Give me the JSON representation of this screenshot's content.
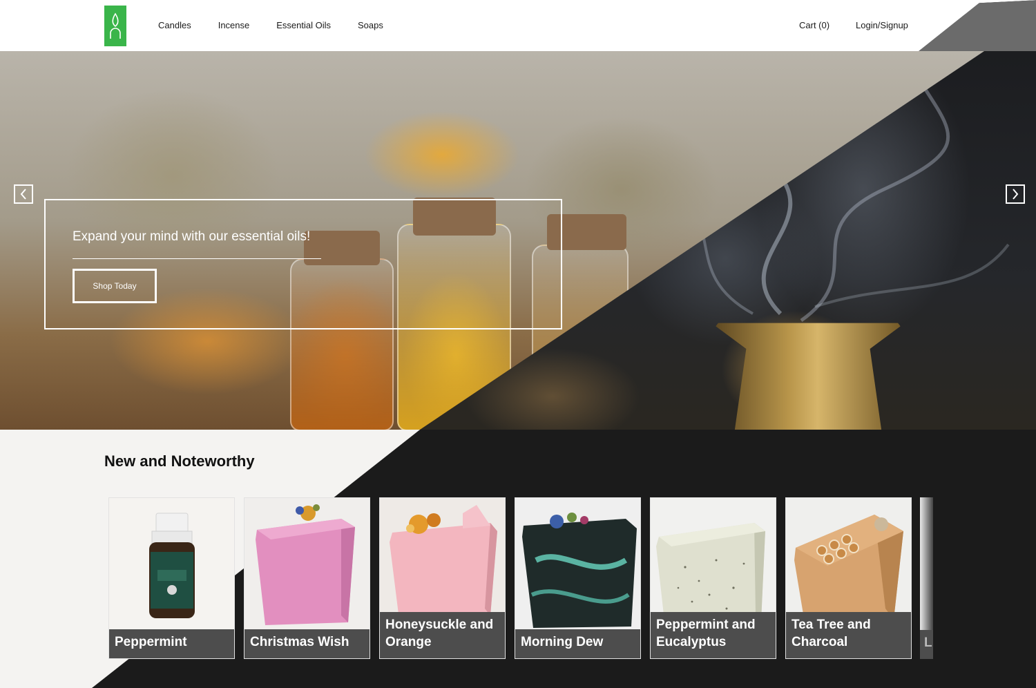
{
  "header": {
    "nav": [
      "Candles",
      "Incense",
      "Essential Oils",
      "Soaps"
    ],
    "cart_label": "Cart (0)",
    "login_label": "Login/Signup",
    "logo_icon": "flame-arch-logo-icon",
    "logo_color": "#3ab54a"
  },
  "hero": {
    "headline": "Expand your mind with our essential oils!",
    "cta_label": "Shop Today",
    "prev_icon": "chevron-left-icon",
    "next_icon": "chevron-right-icon"
  },
  "section": {
    "title": "New and Noteworthy"
  },
  "products": [
    {
      "name": "Peppermint",
      "line1": "Peppermint",
      "line2": ""
    },
    {
      "name": "Christmas Wish",
      "line1": "Christmas Wish",
      "line2": ""
    },
    {
      "name": "Honeysuckle and Orange",
      "line1": "Honeysuckle and",
      "line2": "Orange"
    },
    {
      "name": "Morning Dew",
      "line1": "Morning Dew",
      "line2": ""
    },
    {
      "name": "Peppermint and Eucalyptus",
      "line1": "Peppermint and",
      "line2": "Eucalyptus"
    },
    {
      "name": "Tea Tree and Charcoal",
      "line1": "Tea Tree and",
      "line2": "Charcoal"
    },
    {
      "name": "L",
      "line1": "L",
      "line2": ""
    }
  ],
  "colors": {
    "header_bg": "#ffffff",
    "dark_panel": "#1b1b1b",
    "card_label_bg": "#4d4d4d"
  }
}
